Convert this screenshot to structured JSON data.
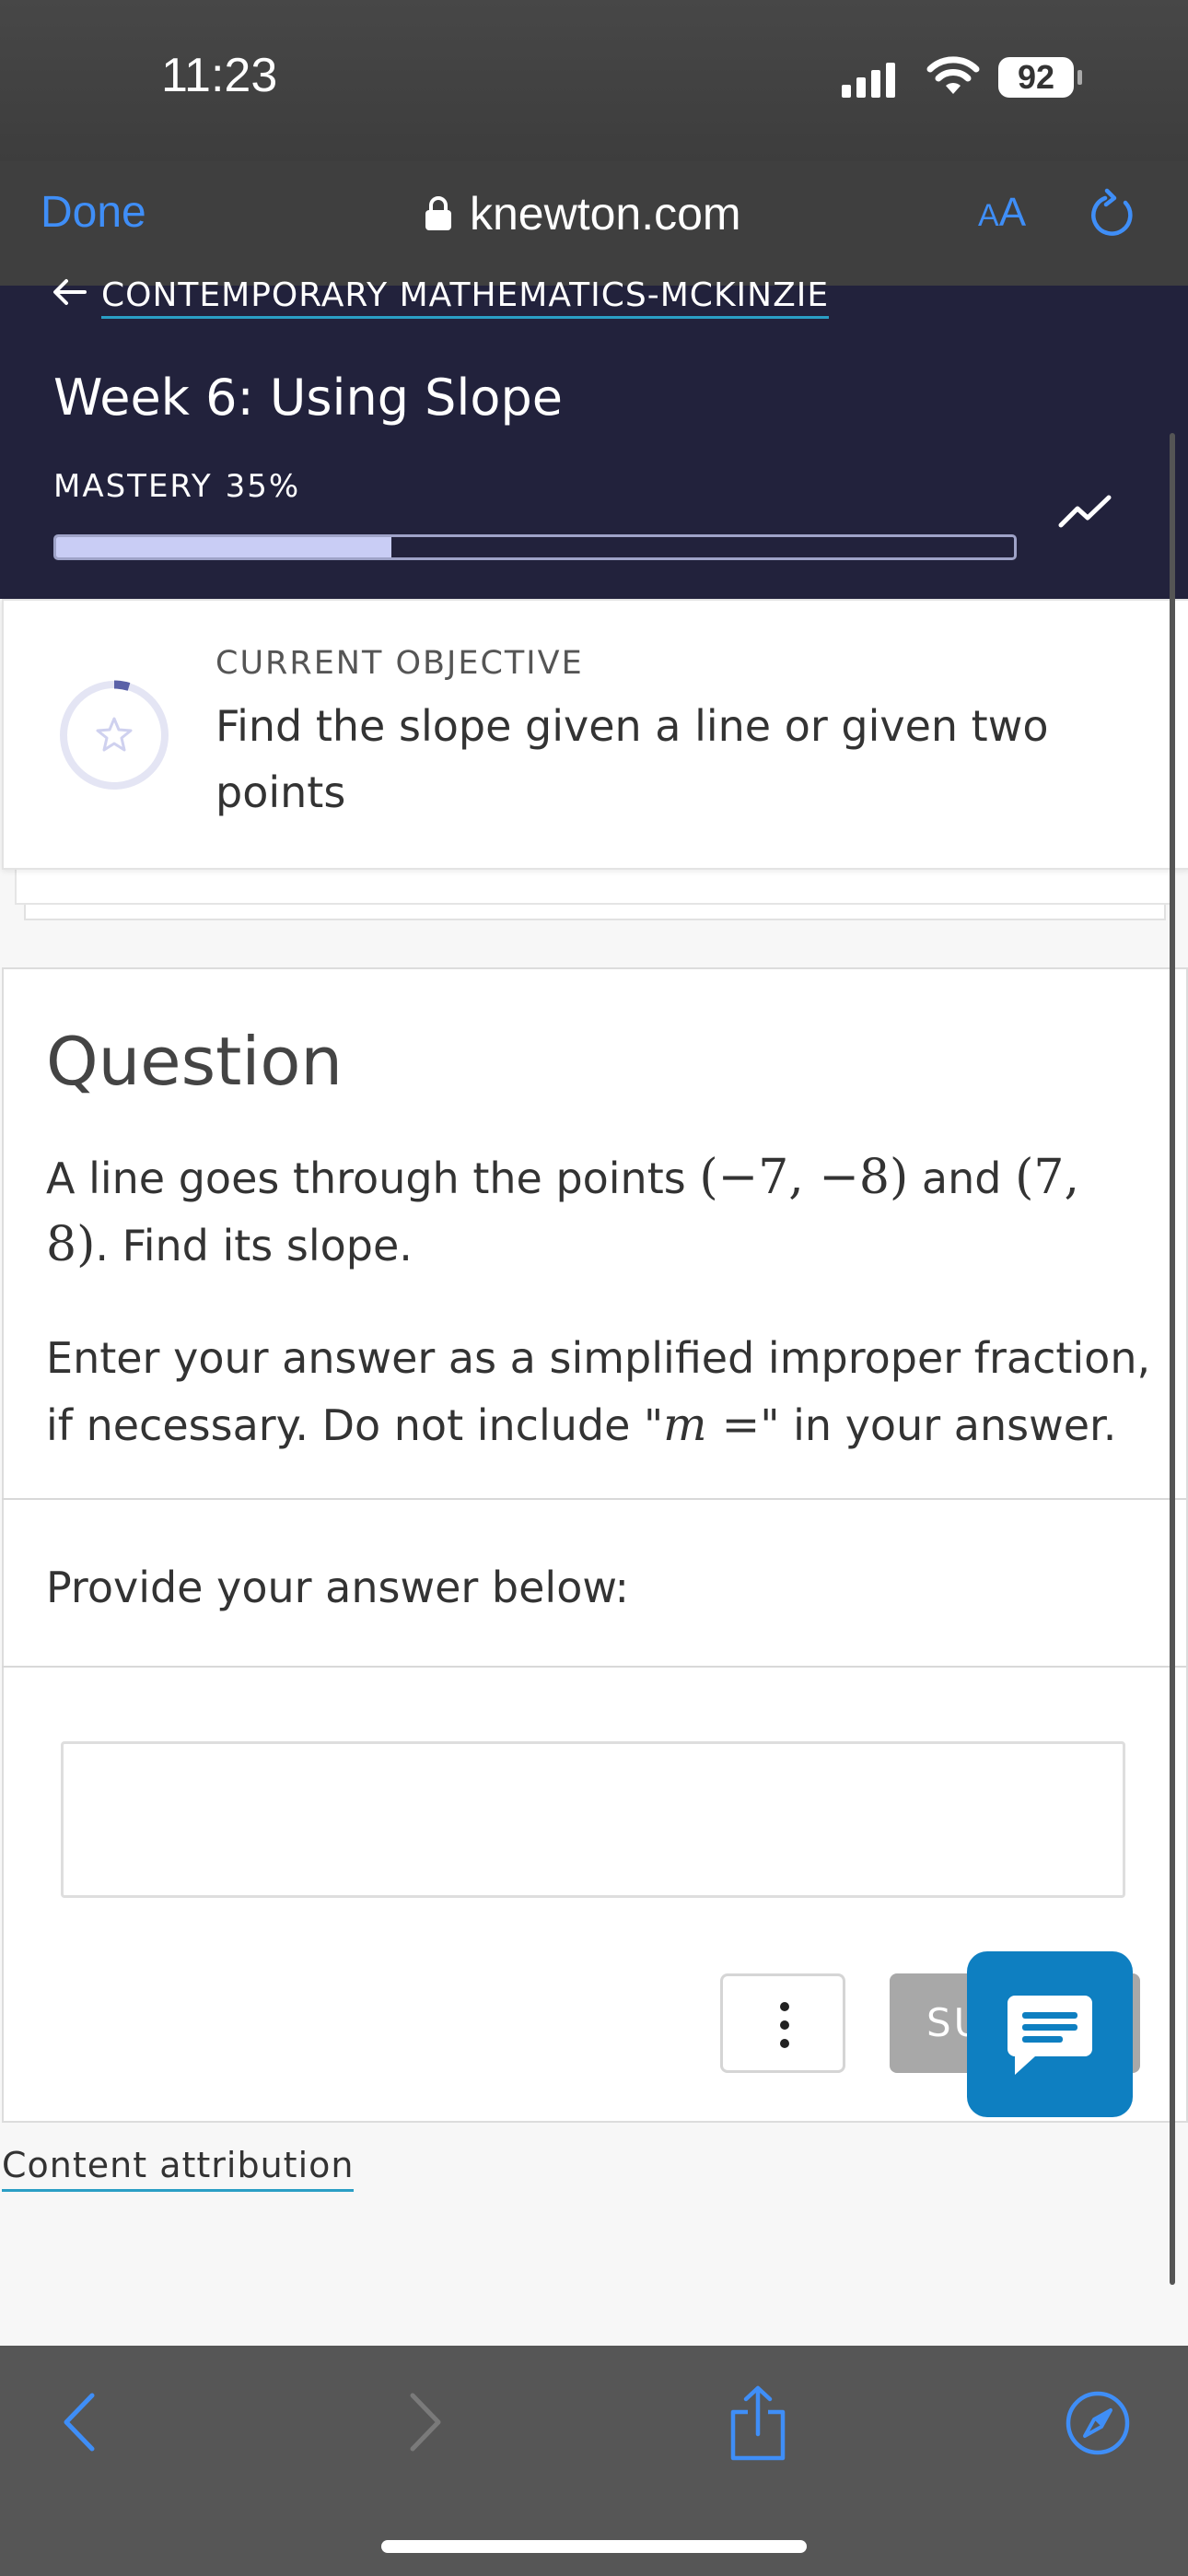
{
  "status_bar": {
    "time": "11:23",
    "battery": "92"
  },
  "browser": {
    "done_label": "Done",
    "domain": "knewton.com",
    "aa_label_small": "A",
    "aa_label_large": "A"
  },
  "course": {
    "back_link": "CONTEMPORARY MATHEMATICS-MCKINZIE",
    "week_title": "Week 6: Using Slope",
    "mastery_label": "MASTERY",
    "mastery_value": "35%",
    "mastery_fraction": 0.35
  },
  "objective": {
    "label": "CURRENT OBJECTIVE",
    "text": "Find the slope given a line or given two points"
  },
  "question": {
    "title": "Question",
    "body_prefix": "A line goes through the points ",
    "point_1": "(−7, −8)",
    "body_and": " and ",
    "point_2": "(7, 8)",
    "body_suffix": ". Find its slope.",
    "instructions_prefix": "Enter your answer as a simplified improper fraction, if necessary. Do not include \"",
    "instructions_math": "m =",
    "instructions_suffix": "\" in your answer.",
    "provide_label": "Provide your answer below:",
    "answer_value": "",
    "submit_label": "SU"
  },
  "footer": {
    "attribution": "Content attribution"
  },
  "colors": {
    "header_bg": "#22223c",
    "link_underline": "#2a9ec5",
    "safari_blue": "#3f8ef7",
    "chat_blue": "#0e7fc1",
    "progress_fill": "#c9cdf5"
  },
  "icons": {
    "lock": "lock-icon",
    "reload": "reload-icon",
    "back": "arrow-left-icon",
    "trend": "trend-icon",
    "star": "star-icon",
    "chat": "chat-icon",
    "more": "more-vertical-icon",
    "safari_back": "chevron-left-icon",
    "safari_forward": "chevron-right-icon",
    "share": "share-icon",
    "compass": "compass-icon"
  }
}
